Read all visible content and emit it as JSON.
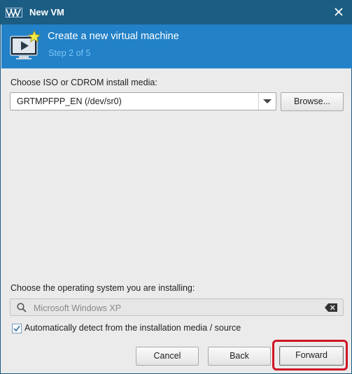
{
  "window": {
    "title": "New VM"
  },
  "header": {
    "title": "Create a new virtual machine",
    "step": "Step 2 of 5"
  },
  "install_media": {
    "label": "Choose ISO or CDROM install media:",
    "selected": "GRTMPFPP_EN (/dev/sr0)",
    "browse_label": "Browse..."
  },
  "os": {
    "label": "Choose the operating system you are installing:",
    "search_placeholder": "Microsoft Windows XP",
    "autodetect_label": "Automatically detect from the installation media / source",
    "autodetect_checked": true
  },
  "buttons": {
    "cancel": "Cancel",
    "back": "Back",
    "forward": "Forward"
  },
  "colors": {
    "titlebar": "#1c5d83",
    "banner": "#2281c7",
    "step_text": "#7cc3f5",
    "highlight": "#d01525"
  },
  "icons": {
    "app": "virt-manager-logo-icon",
    "close": "close-icon",
    "header": "vm-monitor-star-icon",
    "search": "search-icon",
    "clear": "clear-text-icon",
    "dropdown": "chevron-down-icon"
  }
}
